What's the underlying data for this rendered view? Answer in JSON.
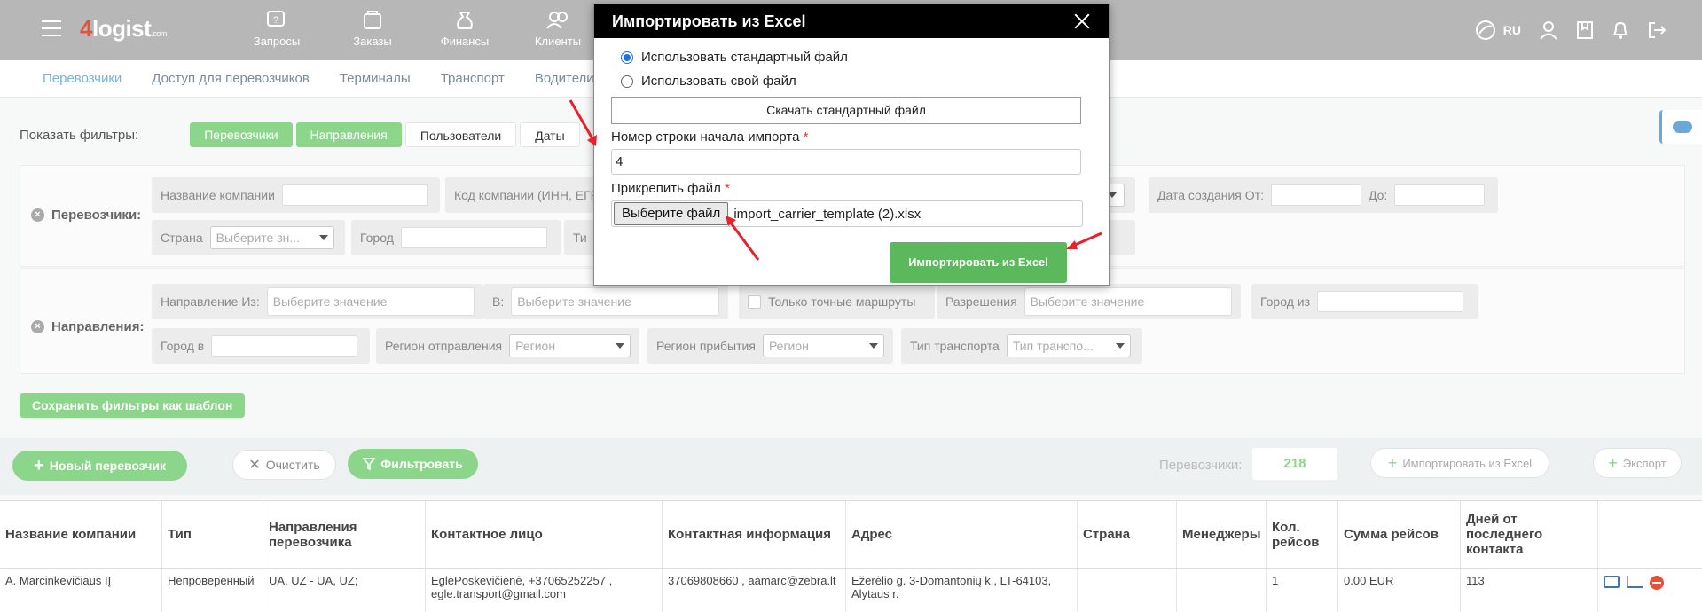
{
  "topbar": {
    "logo_text": "logist",
    "logo_digit": "4",
    "logo_suffix": ".com",
    "nav": [
      {
        "label": "Запросы",
        "icon": "requests-icon"
      },
      {
        "label": "Заказы",
        "icon": "orders-icon"
      },
      {
        "label": "Финансы",
        "icon": "finance-icon"
      },
      {
        "label": "Клиенты",
        "icon": "clients-icon"
      }
    ],
    "lang": "RU"
  },
  "subnav": [
    "Перевозчики",
    "Доступ для перевозчиков",
    "Терминалы",
    "Транспорт",
    "Водители"
  ],
  "filters": {
    "show_label": "Показать фильтры:",
    "tabs": [
      "Перевозчики",
      "Направления",
      "Пользователи",
      "Даты"
    ],
    "carriers_title": "Перевозчики:",
    "directions_title": "Направления:",
    "company_name": "Название компании",
    "company_code": "Код компании (ИНН, ЕГР",
    "created_from": "Дата создания От:",
    "created_to": "До:",
    "country": "Страна",
    "country_placeholder": "Выберите зн...",
    "city": "Город",
    "type_prefix": "Ти",
    "dir_from": "Направление Из:",
    "dir_from_placeholder": "Выберите значение",
    "dir_to": "В:",
    "dir_to_placeholder": "Выберите значение",
    "exact_routes": "Только точные маршруты",
    "permissions": "Разрешения",
    "permissions_placeholder": "Выберите значение",
    "city_from": "Город из",
    "city_to": "Город в",
    "region_dep": "Регион отправления",
    "region_arr": "Регион прибытия",
    "region_placeholder": "Регион",
    "transport_type": "Тип транспорта",
    "transport_placeholder": "Тип транспо...",
    "save_template": "Сохранить фильтры как шаблон"
  },
  "actions": {
    "new_carrier": "Новый перевозчик",
    "clear": "Очистить",
    "filter": "Фильтровать",
    "count_label": "Перевозчики:",
    "count": "218",
    "import_excel": "Импортировать из Excel",
    "export": "Экспорт"
  },
  "table": {
    "headers": [
      "Название компании",
      "Тип",
      "Направления перевозчика",
      "Контактное лицо",
      "Контактная информация",
      "Адрес",
      "Страна",
      "Менеджеры",
      "Кол. рейсов",
      "Сумма рейсов",
      "Дней от последнего контакта",
      ""
    ],
    "row": [
      "A. Marcinkevičiaus IĮ",
      "Непроверенный",
      "UA, UZ - UA, UZ;",
      "EglėPoskevičienė, +37065252257 , egle.transport@gmail.com",
      "37069808660 , aamarc@zebra.lt",
      "Ežerėlio g. 3-Domantonių k., LT-64103, Alytaus r.",
      "",
      "",
      "1",
      "0.00 EUR",
      "113",
      ""
    ]
  },
  "modal": {
    "title": "Импортировать из Excel",
    "radio_standard": "Использовать стандартный файл",
    "radio_custom": "Использовать свой файл",
    "download_btn": "Скачать стандартный файл",
    "row_label": "Номер строки начала импорта",
    "row_value": "4",
    "attach_label": "Прикрепить файл",
    "required_mark": "*",
    "choose_file": "Выберите файл",
    "file_name": "import_carrier_template (2).xlsx",
    "import_btn": "Импортировать из Excel"
  },
  "colors": {
    "accent_green": "#8cd68c",
    "import_green": "#5cb85c",
    "annotation_red": "#e8202a"
  }
}
